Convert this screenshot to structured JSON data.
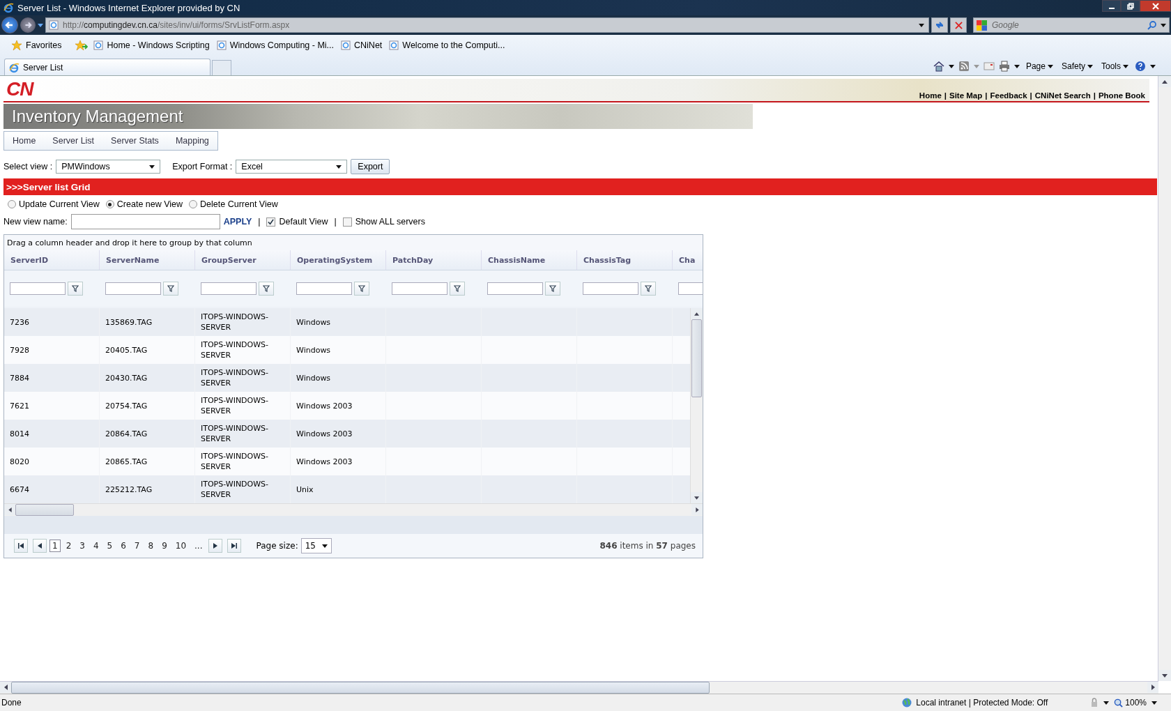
{
  "browser": {
    "title": "Server List - Windows Internet Explorer provided by CN",
    "address": {
      "scheme": "http://",
      "host": "computingdev.cn.ca",
      "path": "/sites/inv/ui/forms/SrvListForm.aspx"
    },
    "search": {
      "placeholder": "Google"
    },
    "favorites": {
      "label": "Favorites",
      "links": [
        "Home - Windows Scripting",
        "Windows Computing - Mi...",
        "CNiNet",
        "Welcome to the Computi..."
      ]
    },
    "tabs": [
      {
        "label": "Server List",
        "selected": true
      }
    ],
    "commands": [
      "Page",
      "Safety",
      "Tools"
    ]
  },
  "page": {
    "logo": "CN",
    "top_links": [
      "Home",
      "Site Map",
      "Feedback",
      "CNiNet Search",
      "Phone Book"
    ],
    "separator": "|",
    "banner_title": "Inventory Management",
    "nav": [
      "Home",
      "Server List",
      "Server Stats",
      "Mapping"
    ],
    "select_view": {
      "label": "Select view :",
      "value": "PMWindows"
    },
    "export_format": {
      "label": "Export Format :",
      "value": "Excel"
    },
    "export_button": "Export",
    "section_title": ">>>Server list Grid",
    "view_modes": [
      {
        "label": "Update Current View",
        "selected": false
      },
      {
        "label": "Create new View",
        "selected": true
      },
      {
        "label": "Delete Current View",
        "selected": false
      }
    ],
    "new_view": {
      "label": "New view name:",
      "apply": "APPLY"
    },
    "options": [
      {
        "label": "Default View",
        "checked": true
      },
      {
        "label": "Show ALL servers",
        "checked": false
      }
    ],
    "grid": {
      "group_hint": "Drag a column header and drop it here to group by that column",
      "columns": [
        "ServerID",
        "ServerName",
        "GroupServer",
        "OperatingSystem",
        "PatchDay",
        "ChassisName",
        "ChassisTag",
        "Cha"
      ],
      "rows": [
        [
          "7236",
          "135869.TAG",
          "ITOPS-WINDOWS-SERVER",
          "Windows"
        ],
        [
          "7928",
          "20405.TAG",
          "ITOPS-WINDOWS-SERVER",
          "Windows"
        ],
        [
          "7884",
          "20430.TAG",
          "ITOPS-WINDOWS-SERVER",
          "Windows"
        ],
        [
          "7621",
          "20754.TAG",
          "ITOPS-WINDOWS-SERVER",
          "Windows 2003"
        ],
        [
          "8014",
          "20864.TAG",
          "ITOPS-WINDOWS-SERVER",
          "Windows 2003"
        ],
        [
          "8020",
          "20865.TAG",
          "ITOPS-WINDOWS-SERVER",
          "Windows 2003"
        ],
        [
          "6674",
          "225212.TAG",
          "ITOPS-WINDOWS-SERVER",
          "Unix"
        ]
      ],
      "pages": [
        {
          "label": "1",
          "selected": true
        },
        {
          "label": "2",
          "selected": false
        },
        {
          "label": "3",
          "selected": false
        },
        {
          "label": "4",
          "selected": false
        },
        {
          "label": "5",
          "selected": false
        },
        {
          "label": "6",
          "selected": false
        },
        {
          "label": "7",
          "selected": false
        },
        {
          "label": "8",
          "selected": false
        },
        {
          "label": "9",
          "selected": false
        },
        {
          "label": "10",
          "selected": false
        },
        {
          "label": "...",
          "selected": false
        }
      ],
      "page_size_label": "Page size:",
      "page_size": "15",
      "summary": "**846** items in **57** pages"
    }
  },
  "status": {
    "text": "Done",
    "zone": "Local intranet | Protected Mode: Off",
    "zoom": "100%"
  }
}
